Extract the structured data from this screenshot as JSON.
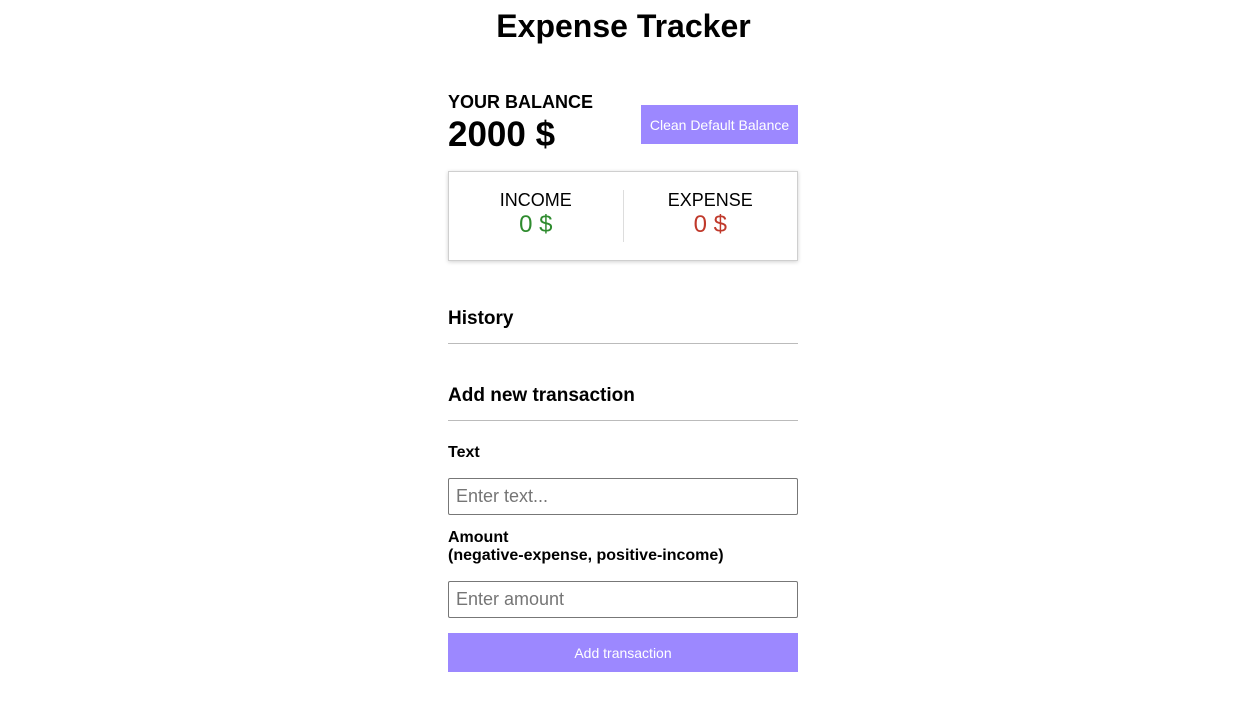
{
  "app": {
    "title": "Expense Tracker"
  },
  "balance": {
    "label": "YOUR BALANCE",
    "value": "2000 $",
    "clean_button_label": "Clean Default Balance"
  },
  "summary": {
    "income_label": "INCOME",
    "income_value": "0 $",
    "expense_label": "EXPENSE",
    "expense_value": "0 $"
  },
  "history": {
    "heading": "History"
  },
  "form": {
    "heading": "Add new transaction",
    "text_label": "Text",
    "text_placeholder": "Enter text...",
    "text_value": "",
    "amount_label_line1": "Amount",
    "amount_label_line2": "(negative-expense, positive-income)",
    "amount_placeholder": "Enter amount",
    "amount_value": "",
    "submit_label": "Add transaction"
  },
  "colors": {
    "accent": "#9c88ff",
    "income": "#2e8b2e",
    "expense": "#c0392b"
  }
}
